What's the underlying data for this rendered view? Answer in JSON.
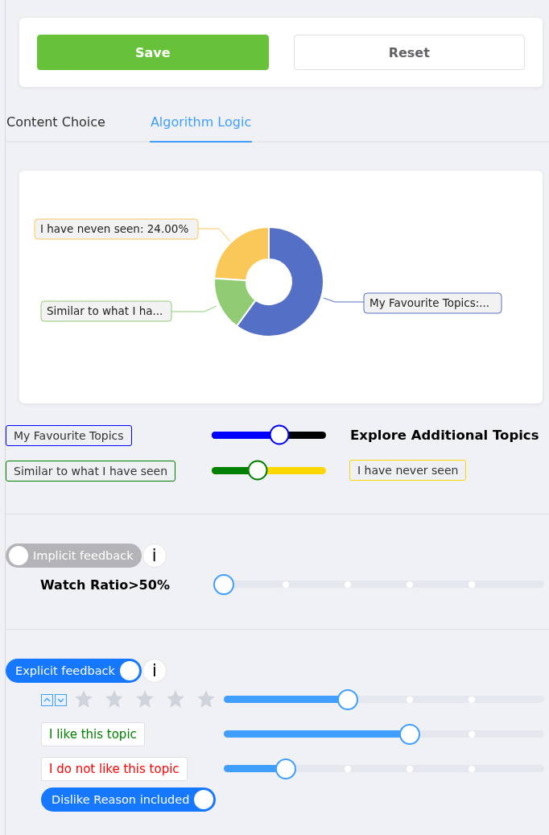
{
  "actions": [
    {
      "label": "Save",
      "kind": "primary"
    },
    {
      "label": "Reset",
      "kind": "secondary"
    }
  ],
  "tabs": [
    {
      "label": "Content Choice",
      "selected": false
    },
    {
      "label": "Algorithm Logic",
      "selected": true
    }
  ],
  "chart": {
    "kind": "donut",
    "slices": [
      {
        "label": "I have neven seen: 24.00%",
        "color": "#fac858"
      },
      {
        "label": "My Favourite Topics:...",
        "color": "#5470c6"
      },
      {
        "label": "Similar to what I ha...",
        "color": "#91cc75"
      }
    ]
  },
  "mix": [
    {
      "left": {
        "label": "My Favourite Topics",
        "color": "#0000ff"
      },
      "level": 0.59,
      "right": {
        "kind": "title",
        "label": "Explore Additional Topics",
        "color": "#000000"
      }
    },
    {
      "left": {
        "label": "Similar to what I have seen",
        "color": "#008000"
      },
      "level": 0.4,
      "right": {
        "kind": "tag",
        "label": "I have never seen",
        "color": "#ffd700"
      }
    }
  ],
  "implicit": {
    "toggle": {
      "label": "Implicit feedback",
      "on": false
    },
    "info": "i",
    "metric": "Watch Ratio>50%",
    "level": 0
  },
  "explicit": {
    "toggle": {
      "label": "Explicit feedback",
      "on": true
    },
    "info": "i",
    "rows": [
      {
        "kind": "stars",
        "stars": 0,
        "level": 0.4
      },
      {
        "kind": "tag",
        "label": "I like this topic",
        "color": "#008000",
        "level": 0.6
      },
      {
        "kind": "tag",
        "label": "I do not like this topic",
        "color": "#ff0000",
        "level": 0.2
      }
    ],
    "dislike_toggle": {
      "label": "Dislike Reason included",
      "on": true
    }
  }
}
